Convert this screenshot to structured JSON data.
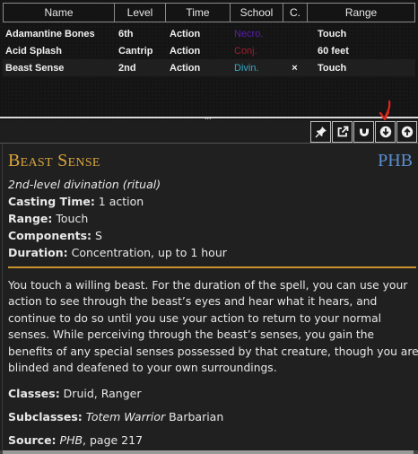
{
  "table": {
    "headers": [
      "Name",
      "Level",
      "Time",
      "School",
      "C.",
      "Range"
    ],
    "rows": [
      {
        "name": "Adamantine Bones",
        "level": "6th",
        "time": "Action",
        "school": "Necro.",
        "school_color": "#5a1fb0",
        "concentration": "",
        "range": "Touch"
      },
      {
        "name": "Acid Splash",
        "level": "Cantrip",
        "time": "Action",
        "school": "Conj.",
        "school_color": "#9b1e2e",
        "concentration": "",
        "range": "60 feet"
      },
      {
        "name": "Beast Sense",
        "level": "2nd",
        "time": "Action",
        "school": "Divin.",
        "school_color": "#36a9c9",
        "concentration": "×",
        "range": "Touch"
      }
    ]
  },
  "splitter_grip": "...",
  "toolbar": {
    "icons": [
      "pin-icon",
      "popout-icon",
      "magnet-icon",
      "download-icon",
      "upload-icon"
    ],
    "annotation_color": "#e0261c"
  },
  "spell": {
    "title": "Beast Sense",
    "source_abbr": "PHB",
    "subtitle": "2nd-level divination (ritual)",
    "casting_time_label": "Casting Time:",
    "casting_time": " 1 action",
    "range_label": "Range:",
    "range": " Touch",
    "components_label": "Components:",
    "components": " S",
    "duration_label": "Duration:",
    "duration": " Concentration, up to 1 hour",
    "description": "You touch a willing beast. For the duration of the spell, you can use your action to see through the beast’s eyes and hear what it hears, and continue to do so until you use your action to return to your normal senses. While perceiving through the beast’s senses, you gain the benefits of any special senses possessed by that creature, though you are blinded and deafened to your own surroundings.",
    "classes_label": "Classes:",
    "classes": " Druid, Ranger",
    "subclasses_label": "Subclasses:",
    "subclass_name": "Totem Warrior",
    "subclass_base": " Barbarian",
    "source_label": "Source:",
    "source_book": "PHB",
    "source_page": ", page 217"
  },
  "colors": {
    "title": "#d9a53d",
    "source": "#5a8fd0",
    "rule": "#c9922e"
  }
}
